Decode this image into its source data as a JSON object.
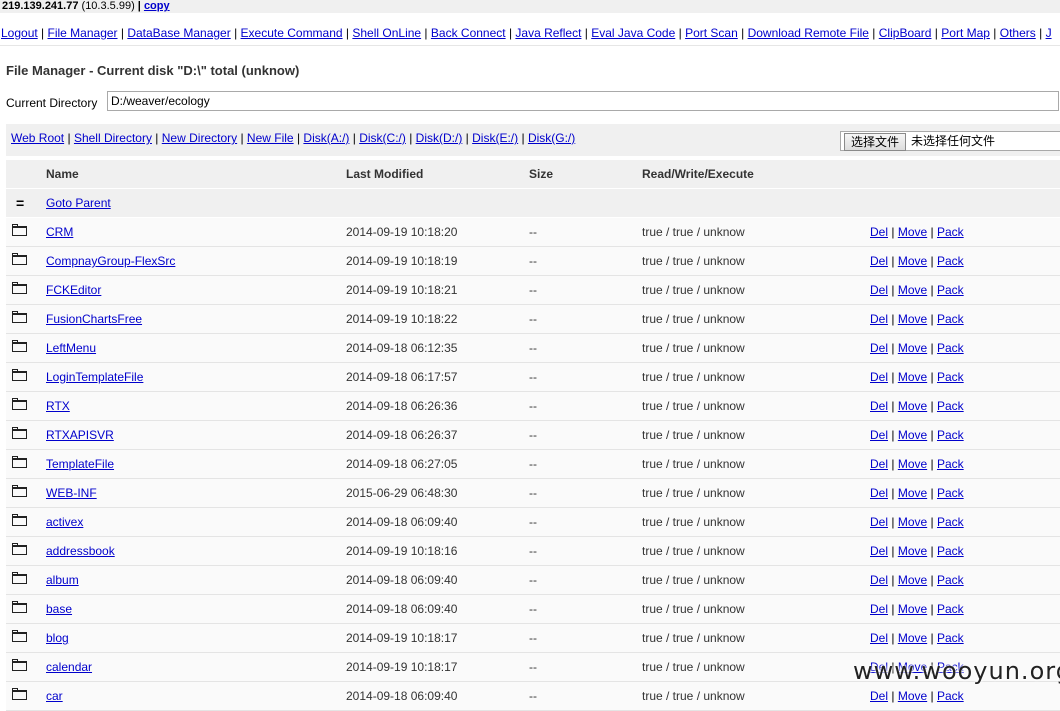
{
  "topbar": {
    "ip": "219.139.241.77",
    "lan": "(10.3.5.99)",
    "sep": "|",
    "copy": "copy"
  },
  "menu": [
    "Logout",
    "File Manager",
    "DataBase Manager",
    "Execute Command",
    "Shell OnLine",
    "Back Connect",
    "Java Reflect",
    "Eval Java Code",
    "Port Scan",
    "Download Remote File",
    "ClipBoard",
    "Port Map",
    "Others",
    "J"
  ],
  "title": "File Manager - Current disk \"D:\\\" total (unknow)",
  "current_dir": {
    "label": "Current Directory",
    "value": "D:/weaver/ecology"
  },
  "nav": [
    "Web Root",
    "Shell Directory",
    "New Directory",
    "New File",
    "Disk(A:/)",
    "Disk(C:/)",
    "Disk(D:/)",
    "Disk(E:/)",
    "Disk(G:/)"
  ],
  "file_upload": {
    "button": "选择文件",
    "status": "未选择任何文件"
  },
  "table": {
    "headers": {
      "name": "Name",
      "modified": "Last Modified",
      "size": "Size",
      "rwx": "Read/Write/Execute"
    },
    "parent": {
      "icon": "=",
      "label": "Goto Parent"
    },
    "actions": {
      "del": "Del",
      "move": "Move",
      "pack": "Pack",
      "sep": "|"
    },
    "rows": [
      {
        "name": "CRM",
        "modified": "2014-09-19 10:18:20",
        "size": "--",
        "rwx": "true / true / unknow"
      },
      {
        "name": "CompnayGroup-FlexSrc",
        "modified": "2014-09-19 10:18:19",
        "size": "--",
        "rwx": "true / true / unknow"
      },
      {
        "name": "FCKEditor",
        "modified": "2014-09-19 10:18:21",
        "size": "--",
        "rwx": "true / true / unknow"
      },
      {
        "name": "FusionChartsFree",
        "modified": "2014-09-19 10:18:22",
        "size": "--",
        "rwx": "true / true / unknow"
      },
      {
        "name": "LeftMenu",
        "modified": "2014-09-18 06:12:35",
        "size": "--",
        "rwx": "true / true / unknow"
      },
      {
        "name": "LoginTemplateFile",
        "modified": "2014-09-18 06:17:57",
        "size": "--",
        "rwx": "true / true / unknow"
      },
      {
        "name": "RTX",
        "modified": "2014-09-18 06:26:36",
        "size": "--",
        "rwx": "true / true / unknow"
      },
      {
        "name": "RTXAPISVR",
        "modified": "2014-09-18 06:26:37",
        "size": "--",
        "rwx": "true / true / unknow"
      },
      {
        "name": "TemplateFile",
        "modified": "2014-09-18 06:27:05",
        "size": "--",
        "rwx": "true / true / unknow"
      },
      {
        "name": "WEB-INF",
        "modified": "2015-06-29 06:48:30",
        "size": "--",
        "rwx": "true / true / unknow"
      },
      {
        "name": "activex",
        "modified": "2014-09-18 06:09:40",
        "size": "--",
        "rwx": "true / true / unknow"
      },
      {
        "name": "addressbook",
        "modified": "2014-09-19 10:18:16",
        "size": "--",
        "rwx": "true / true / unknow"
      },
      {
        "name": "album",
        "modified": "2014-09-18 06:09:40",
        "size": "--",
        "rwx": "true / true / unknow"
      },
      {
        "name": "base",
        "modified": "2014-09-18 06:09:40",
        "size": "--",
        "rwx": "true / true / unknow"
      },
      {
        "name": "blog",
        "modified": "2014-09-19 10:18:17",
        "size": "--",
        "rwx": "true / true / unknow"
      },
      {
        "name": "calendar",
        "modified": "2014-09-19 10:18:17",
        "size": "--",
        "rwx": "true / true / unknow"
      },
      {
        "name": "car",
        "modified": "2014-09-18 06:09:40",
        "size": "--",
        "rwx": "true / true / unknow"
      }
    ]
  },
  "watermark": "www.wooyun.org"
}
